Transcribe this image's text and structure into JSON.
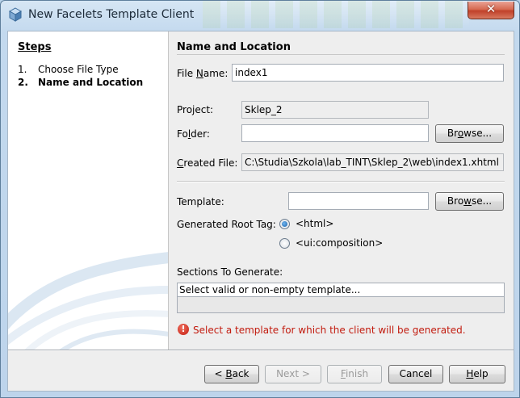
{
  "window": {
    "title": "New Facelets Template Client",
    "close_label": "✕"
  },
  "steps": {
    "title": "Steps",
    "items": [
      {
        "num": "1.",
        "label": "Choose File Type"
      },
      {
        "num": "2.",
        "label": "Name and Location"
      }
    ]
  },
  "panel": {
    "title": "Name and Location",
    "file_name": {
      "label_pre": "File ",
      "label_u": "N",
      "label_post": "ame:",
      "value": "index1"
    },
    "project": {
      "label": "Project:",
      "value": "Sklep_2"
    },
    "folder": {
      "label_pre": "Fo",
      "label_u": "l",
      "label_post": "der:",
      "value": "",
      "browse_pre": "Br",
      "browse_u": "o",
      "browse_post": "wse..."
    },
    "created_file": {
      "label_pre": "",
      "label_u": "C",
      "label_post": "reated File:",
      "value": "C:\\Studia\\Szkola\\lab_TINT\\Sklep_2\\web\\index1.xhtml"
    },
    "template": {
      "label": "Template:",
      "value": "",
      "browse_pre": "Bro",
      "browse_u": "w",
      "browse_post": "se..."
    },
    "root_tag": {
      "label": "Generated Root Tag:",
      "options": [
        {
          "label": "<html>",
          "selected": true
        },
        {
          "label": "<ui:composition>",
          "selected": false
        }
      ]
    },
    "sections": {
      "label": "Sections To Generate:",
      "rows": [
        "Select valid or non-empty template..."
      ]
    },
    "error": {
      "icon": "error-icon",
      "text": "Select a template for which the client will be generated."
    }
  },
  "buttons": {
    "back": {
      "pre": "< ",
      "u": "B",
      "post": "ack"
    },
    "next": "Next >",
    "finish": {
      "pre": "",
      "u": "F",
      "post": "inish"
    },
    "cancel": "Cancel",
    "help": {
      "pre": "",
      "u": "H",
      "post": "elp"
    }
  },
  "colors": {
    "error": "#c21b0e",
    "accent": "#1a5fa8",
    "close_button": "#c8462e"
  }
}
